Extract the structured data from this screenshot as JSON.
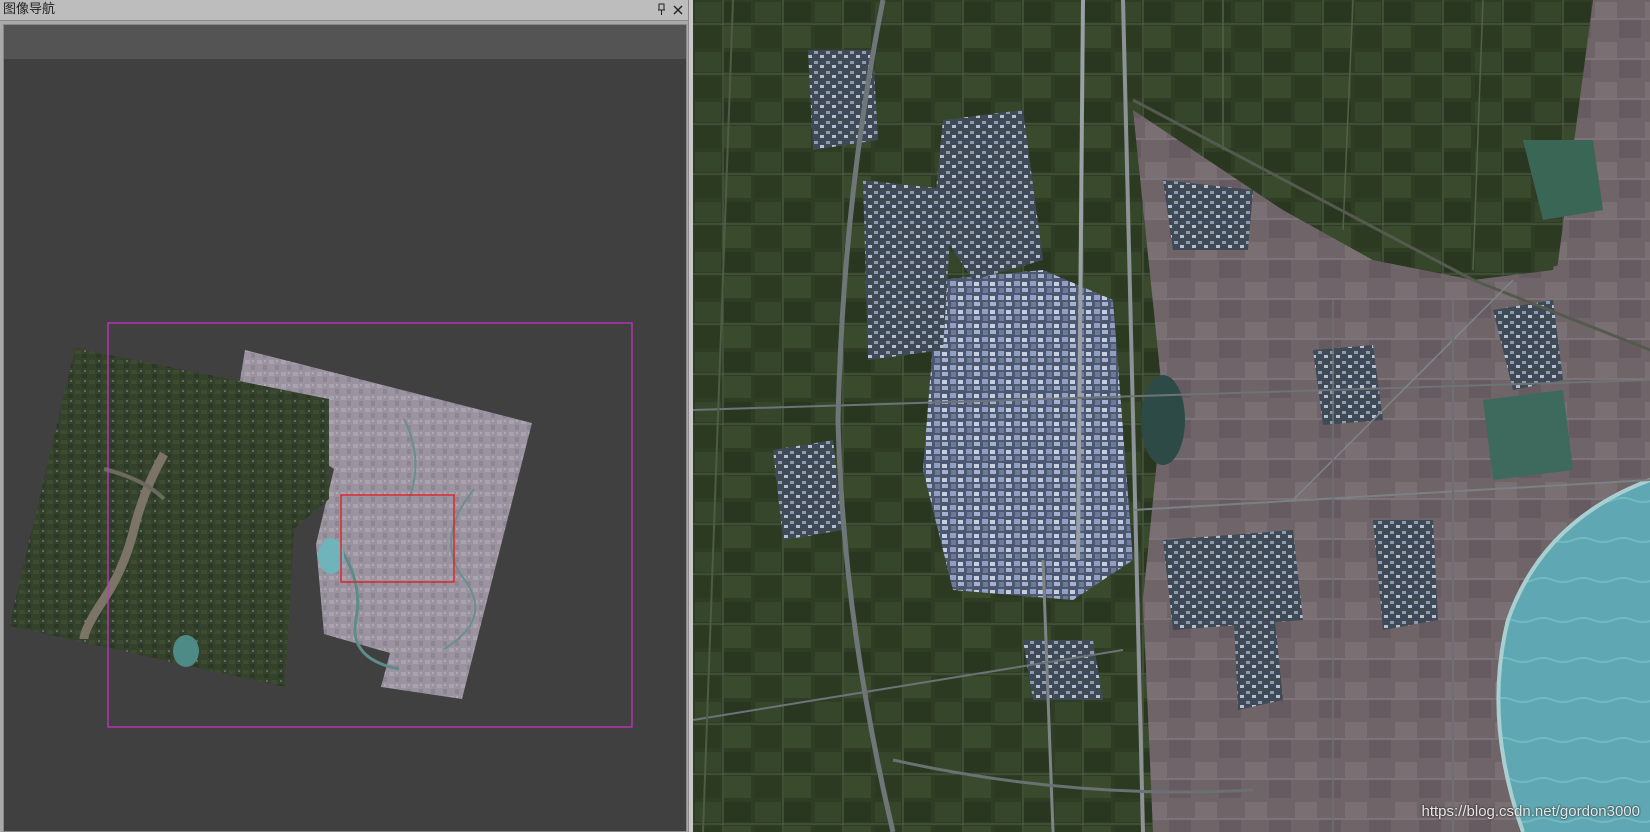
{
  "panel": {
    "title": "图像导航",
    "pin_icon": "pin-icon",
    "close_icon": "close-icon"
  },
  "overview": {
    "extent_color": "#cc33cc",
    "viewport_color": "#e02020"
  },
  "watermark": "https://blog.csdn.net/gordon3000",
  "colors": {
    "panel_bg": "#404040",
    "toolbar_bg": "#545454",
    "water": "#6fb3bb"
  }
}
